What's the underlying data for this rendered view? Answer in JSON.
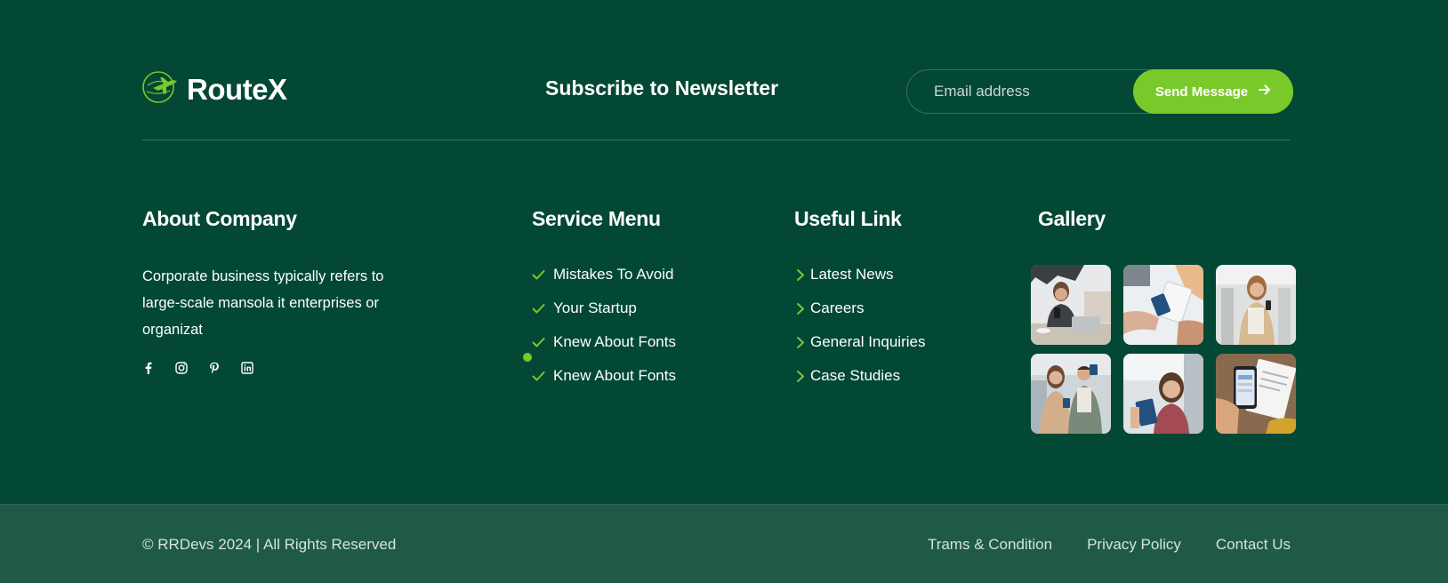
{
  "brand": {
    "name": "RouteX",
    "logo_icon": "airplane-globe-icon",
    "accent_color": "#7ac92a",
    "background_color": "#034834"
  },
  "newsletter": {
    "title": "Subscribe to Newsletter",
    "email_placeholder": "Email address",
    "email_value": "",
    "button_label": "Send Message",
    "button_icon": "arrow-right-icon"
  },
  "about": {
    "title": "About Company",
    "text": "Corporate business typically refers to large-scale mansola it enterprises or organizat",
    "socials": [
      "facebook-icon",
      "instagram-icon",
      "pinterest-icon",
      "linkedin-icon"
    ]
  },
  "service_menu": {
    "title": "Service Menu",
    "items": [
      {
        "label": "Mistakes To Avoid"
      },
      {
        "label": "Your Startup"
      },
      {
        "label": "Knew About Fonts"
      },
      {
        "label": "Knew About Fonts"
      }
    ]
  },
  "useful_link": {
    "title": "Useful Link",
    "items": [
      {
        "label": "Latest News"
      },
      {
        "label": "Careers"
      },
      {
        "label": "General Inquiries"
      },
      {
        "label": "Case Studies"
      }
    ]
  },
  "gallery": {
    "title": "Gallery",
    "images": [
      "woman-with-phone-laptop-photo",
      "hands-holding-passport-photo",
      "woman-with-phone-airport-photo",
      "couple-with-passports-photo",
      "woman-holding-passport-photo",
      "phone-and-documents-photo"
    ]
  },
  "bottom": {
    "copyright": "© RRDevs 2024 | All Rights Reserved",
    "links": [
      {
        "label": "Trams & Condition"
      },
      {
        "label": "Privacy Policy"
      },
      {
        "label": "Contact Us"
      }
    ]
  }
}
